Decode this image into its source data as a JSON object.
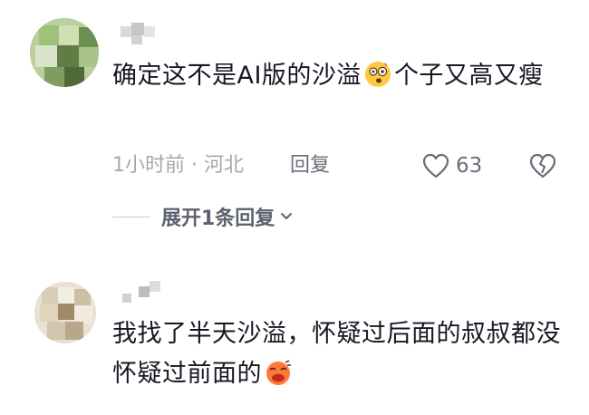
{
  "comments": [
    {
      "text": "确定这不是AI版的沙溢",
      "emoji": "dizzy-face-emoji",
      "text_after": "个子又高又瘦",
      "time_location": "1小时前 · 河北",
      "reply_label": "回复",
      "like_count": "63",
      "expand_label": "展开1条回复"
    },
    {
      "text": "我找了半天沙溢，怀疑过后面的叔叔都没怀疑过前面的",
      "emoji": "laughing-face-emoji"
    }
  ],
  "colors": {
    "text": "#161823",
    "meta": "#a8a8ac",
    "secondary": "#6b6e78"
  }
}
